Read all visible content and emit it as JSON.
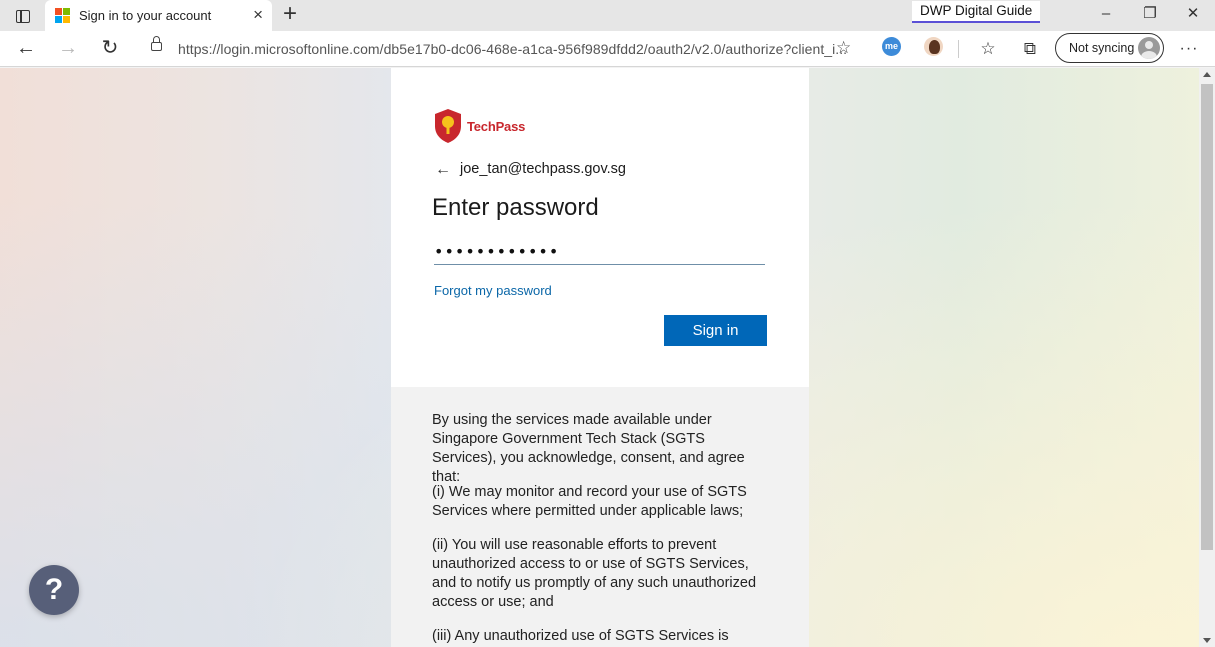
{
  "browser": {
    "tab": {
      "title": "Sign in to your account",
      "close_icon": "×"
    },
    "new_tab_icon": "+",
    "guide_badge": "DWP Digital Guide",
    "window_controls": {
      "minimize": "–",
      "restore": "❐",
      "close": "✕"
    },
    "address": "https://login.microsoftonline.com/db5e17b0-dc06-468e-a1ca-956f989dfdd2/oauth2/v2.0/authorize?client_i...",
    "nav": {
      "back": "←",
      "forward": "→",
      "refresh": "↻"
    },
    "toolbar_icons": {
      "add_favorite": "☆",
      "favorites": "☆",
      "collections": "⧉",
      "more": "···",
      "extension_me": "me"
    },
    "profile_label": "Not syncing",
    "colors": {
      "accent": "#0067b8",
      "brand": "#c8272d"
    }
  },
  "login": {
    "brand": "TechPass",
    "email": "joe_tan@techpass.gov.sg",
    "back_icon": "←",
    "heading": "Enter password",
    "password_value": "••••••••••••",
    "forgot_link": "Forgot my password",
    "signin_button": "Sign in"
  },
  "terms": {
    "intro": "By using the services made available under Singapore Government Tech Stack (SGTS Services), you acknowledge, consent, and agree that:",
    "item1": "(i) We may monitor and record your use of SGTS Services where permitted under applicable laws;",
    "item2": "(ii) You will use reasonable efforts to prevent unauthorized access to or use of SGTS Services, and to notify us promptly of any such unauthorized access or use; and",
    "item3": "(iii) Any unauthorized use of SGTS Services is strictly"
  },
  "help_button": "?"
}
